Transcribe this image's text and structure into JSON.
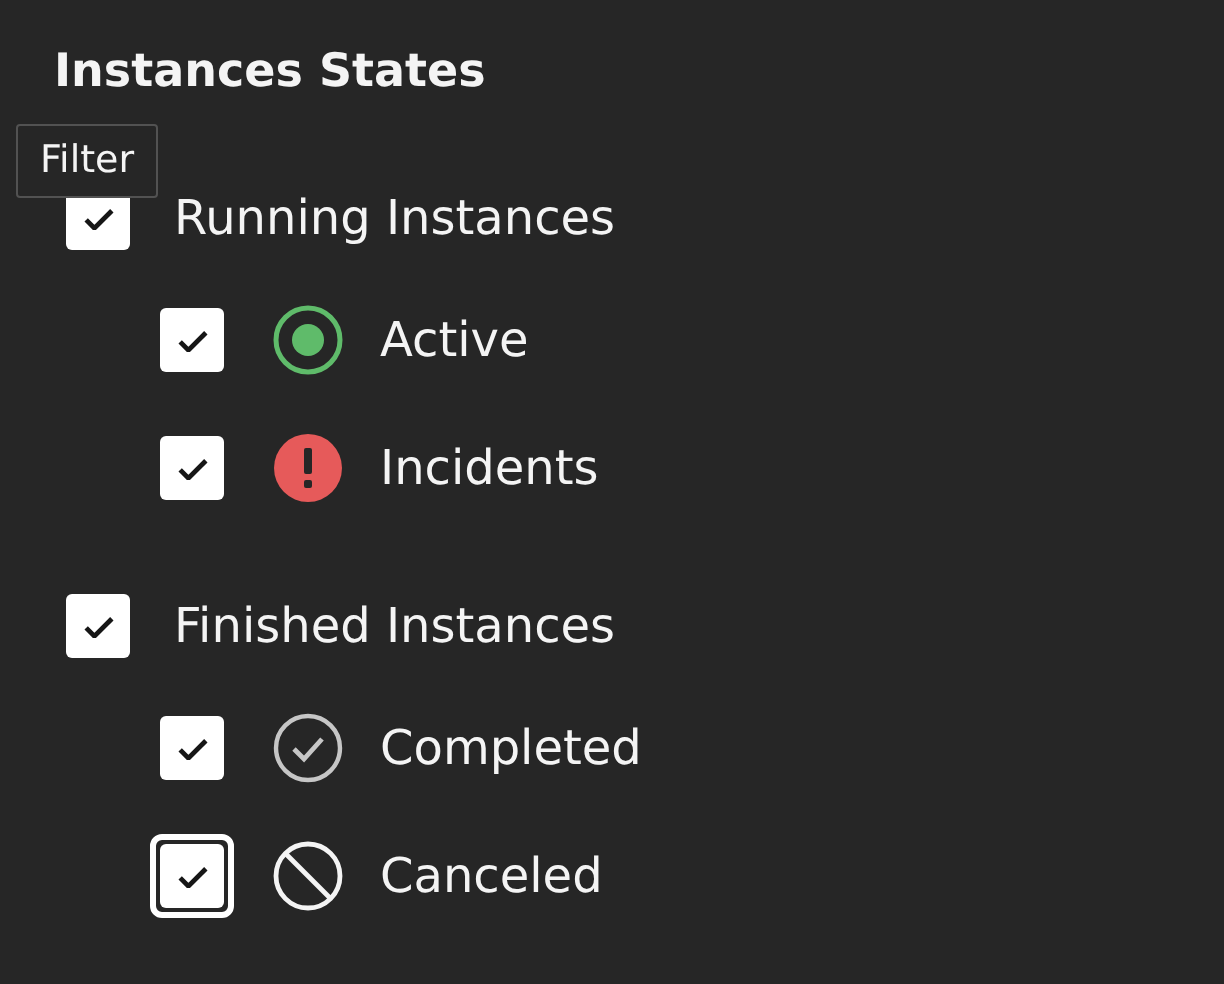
{
  "title": "Instances States",
  "tooltip": "Filter",
  "groups": [
    {
      "label": "Running Instances",
      "checked": true,
      "focused": false,
      "children": [
        {
          "label": "Active",
          "kind": "active",
          "checked": true,
          "focused": false
        },
        {
          "label": "Incidents",
          "kind": "incident",
          "checked": true,
          "focused": false
        }
      ]
    },
    {
      "label": "Finished Instances",
      "checked": true,
      "focused": false,
      "children": [
        {
          "label": "Completed",
          "kind": "completed",
          "checked": true,
          "focused": false
        },
        {
          "label": "Canceled",
          "kind": "canceled",
          "checked": true,
          "focused": true
        }
      ]
    }
  ]
}
